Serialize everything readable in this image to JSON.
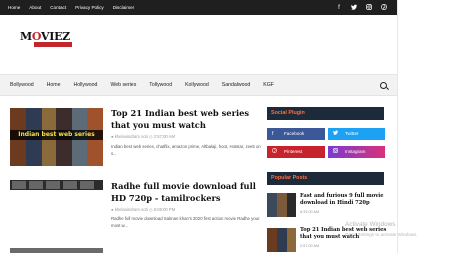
{
  "topbar": {
    "links": [
      "Home",
      "About",
      "Contact",
      "Privacy Policy",
      "Disclaimer"
    ],
    "social_icons": [
      "facebook-icon",
      "twitter-icon",
      "instagram-icon",
      "pinterest-icon"
    ]
  },
  "logo": {
    "main_before": "M",
    "main_v": "O",
    "main_after": "VIEZ",
    "sub": ""
  },
  "nav": {
    "items": [
      "Bollywood",
      "Home",
      "Hollywood",
      "Web series",
      "Tollywood",
      "Kollywood",
      "Sandalwood",
      "KGF"
    ],
    "search_icon": "search-icon"
  },
  "posts": [
    {
      "title": "Top 21 Indian best web series that you must watch",
      "author": "khelaoindram ooti",
      "time": "2:57:00 AM",
      "excerpt": "Indian best web series, chatflix, amazon prime, Altbalaji, hoot, Hotstar, zee5 on s...",
      "thumb_banner": "Indian best web series"
    },
    {
      "title": "Radhe full movie download full HD 720p - tamilrockers",
      "author": "khelaoindram ooti",
      "time": "6:06:00 PM",
      "excerpt": "Radhe full movie download Salman khan's 2020 first action movie Radhe your most w..."
    }
  ],
  "sidebar": {
    "social_plugin_title": "Social Plugin",
    "social_buttons": [
      {
        "label": "Facebook",
        "icon": "facebook-icon",
        "color": "#3b5998"
      },
      {
        "label": "Twitter",
        "icon": "twitter-icon",
        "color": "#1da1f2"
      },
      {
        "label": "Pinterest",
        "icon": "pinterest-icon",
        "color": "#c8232c"
      },
      {
        "label": "Instagram",
        "icon": "instagram-icon",
        "color": "#c13584"
      }
    ],
    "popular_posts_title": "Popular Posts",
    "popular_posts": [
      {
        "title": "Fast and furious 9 full movie download in Hindi 720p",
        "date": "8:33:00 AM"
      },
      {
        "title": "Top 21 Indian best web series that you must watch",
        "date": "2:57:00 AM"
      }
    ]
  },
  "watermark": {
    "line1": "Activate Windows",
    "line2": "Go to Settings to activate Windows."
  },
  "colors": {
    "topbar_bg": "#1f1f1f",
    "widget_title_bg": "#1d2a3a",
    "widget_title_fg": "#ff6f3c",
    "brand_red": "#c0282d"
  }
}
